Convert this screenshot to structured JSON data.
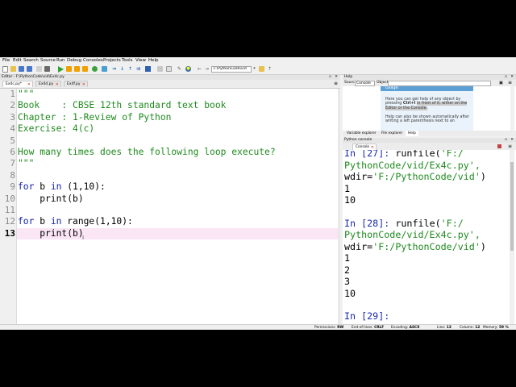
{
  "menu": [
    "File",
    "Edit",
    "Search",
    "Source",
    "Run",
    "Debug",
    "Consoles",
    "Projects",
    "Tools",
    "View",
    "Help"
  ],
  "toolbar": {
    "path_value": "F:\\PythonCode\\vid",
    "back_glyph": "←",
    "forward_glyph": "→"
  },
  "editor": {
    "title": "Editor - F:\\PythonCode\\vid\\Ex4c.py",
    "tabs": [
      "Ex4c.py*",
      "Ex4d.py",
      "Ex4f.py"
    ],
    "current_line": 13,
    "line_numbers": [
      "1",
      "2",
      "3",
      "4",
      "5",
      "6",
      "7",
      "8",
      "9",
      "10",
      "11",
      "12",
      "13"
    ],
    "code": {
      "l1": "\"\"\"",
      "l2": "Book    : CBSE 12th standard text book",
      "l3": "Chapter : 1-Review of Python",
      "l4": "Exercise: 4(c)",
      "l6": "How many times does the following loop execute?",
      "l7": "\"\"\"",
      "l9_kw1": "for",
      "l9_mid": " b ",
      "l9_kw2": "in",
      "l9_rest": " (1,10):",
      "l10": "    print(b)",
      "l12_kw1": "for",
      "l12_mid": " b ",
      "l12_kw2": "in",
      "l12_rest": " range(1,10):",
      "l13": "    print(b)"
    }
  },
  "help": {
    "title": "Help",
    "source_label": "Source",
    "source_value": "Console",
    "object_value": "Object",
    "usage_header": "Usage",
    "usage_p1_a": "Here you can get help of any object by pressing",
    "usage_p1_key": "Ctrl+I",
    "usage_p1_b": "in front of it, either on the Editor or the Console.",
    "usage_p2": "Help can also be shown automatically after writing a left parenthesis next to an",
    "tabs": [
      "Variable explorer",
      "File explorer",
      "Help"
    ]
  },
  "console": {
    "title": "Python console",
    "tab_label": "Console 1/A",
    "lines": {
      "c1_prompt": "In [27]: ",
      "c1_a": "runfile(",
      "c1_str": "'F:/",
      "c2": "PythonCode/vid/Ex4c.py',",
      "c3_a": "wdir=",
      "c3_str": "'F:/PythonCode/vid'",
      "c3_b": ")",
      "c4": "1",
      "c5": "10",
      "c6_prompt": "In [28]: ",
      "c6_a": "runfile(",
      "c6_str": "'F:/",
      "c7": "PythonCode/vid/Ex4c.py',",
      "c8_a": "wdir=",
      "c8_str": "'F:/PythonCode/vid'",
      "c8_b": ")",
      "c9": "1",
      "c10": "2",
      "c11": "3",
      "c12": "10",
      "c13_prompt": "In [29]:"
    }
  },
  "status": {
    "permissions_label": "Permissions:",
    "permissions_value": "RW",
    "eol_label": "End-of-lines:",
    "eol_value": "CRLF",
    "encoding_label": "Encoding:",
    "encoding_value": "ASCII",
    "line_label": "Line:",
    "line_value": "13",
    "column_label": "Column:",
    "column_value": "12",
    "memory_label": "Memory:",
    "memory_value": "59 %"
  }
}
